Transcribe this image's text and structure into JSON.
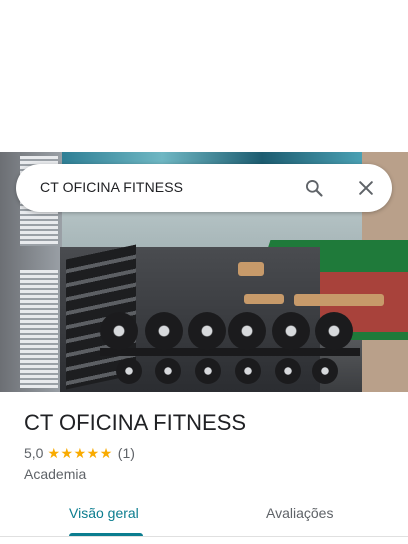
{
  "search": {
    "query": "CT OFICINA FITNESS"
  },
  "place": {
    "title": "CT OFICINA FITNESS",
    "rating": "5,0",
    "stars": 5,
    "review_count": "(1)",
    "category": "Academia"
  },
  "tabs": [
    {
      "label": "Visão geral",
      "active": true
    },
    {
      "label": "Avaliações",
      "active": false
    }
  ],
  "colors": {
    "accent": "#0b7d8f",
    "star": "#f9ab00",
    "text_primary": "#202124",
    "text_secondary": "#5f6368"
  },
  "icons": {
    "search": "search-icon",
    "close": "close-icon",
    "star": "star-icon"
  }
}
